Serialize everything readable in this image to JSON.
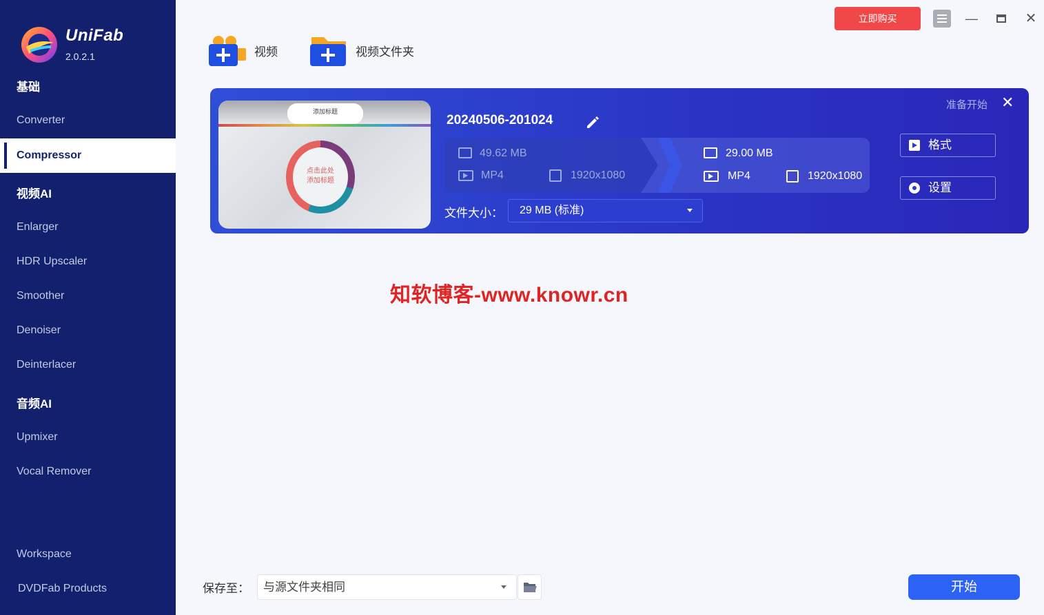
{
  "app": {
    "name": "UniFab",
    "version": "2.0.2.1"
  },
  "sidebar": {
    "sections": [
      {
        "label": "基础",
        "items": [
          "Converter",
          "Compressor"
        ]
      },
      {
        "label": "视频AI",
        "items": [
          "Enlarger",
          "HDR Upscaler",
          "Smoother",
          "Denoiser",
          "Deinterlacer"
        ]
      },
      {
        "label": "音频AI",
        "items": [
          "Upmixer",
          "Vocal Remover"
        ]
      }
    ],
    "active": "Compressor",
    "footer": [
      "Workspace",
      "DVDFab Products"
    ]
  },
  "topbar": {
    "buy_label": "立即购买"
  },
  "toolbar": {
    "add_video": "视频",
    "add_folder": "视频文件夹"
  },
  "task": {
    "filename": "20240506-201024",
    "status": "准备开始",
    "thumbnail": {
      "title": "添加标题",
      "circle_text_1": "点击此处",
      "circle_text_2": "添加标题"
    },
    "source": {
      "size": "49.62 MB",
      "format": "MP4",
      "resolution": "1920x1080"
    },
    "output": {
      "size": "29.00 MB",
      "format": "MP4",
      "resolution": "1920x1080"
    },
    "file_size_label": "文件大小：",
    "file_size_value": "29 MB (标准)",
    "format_button": "格式",
    "settings_button": "设置"
  },
  "watermark": "知软博客-www.knowr.cn",
  "bottom": {
    "save_label": "保存至：",
    "save_value": "与源文件夹相同",
    "start_label": "开始"
  },
  "colors": {
    "sidebar": "#12206e",
    "accent": "#2c63f5",
    "buy": "#f04848",
    "card": "#2f4ed8"
  }
}
